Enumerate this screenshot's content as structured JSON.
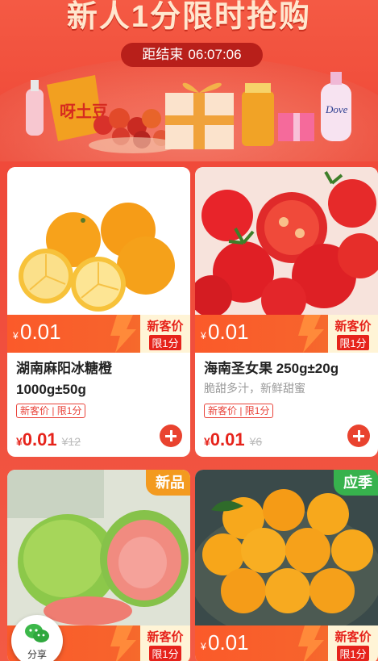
{
  "banner": {
    "title": "新人1分限时抢购",
    "countdown_label": "距结束",
    "countdown_time": "06:07:06"
  },
  "products": [
    {
      "name": "湖南麻阳冰糖橙1000g±50g",
      "subtitle": "",
      "price_currency": "¥",
      "price": "0.01",
      "tag_line1": "新客价",
      "tag_line2": "限1分",
      "badge": "新客价 | 限1分",
      "original_price": "¥12",
      "corner": ""
    },
    {
      "name": "海南圣女果 250g±20g",
      "subtitle": "脆甜多汁，新鲜甜蜜",
      "price_currency": "¥",
      "price": "0.01",
      "tag_line1": "新客价",
      "tag_line2": "限1分",
      "badge": "新客价 | 限1分",
      "original_price": "¥6",
      "corner": ""
    },
    {
      "name": "",
      "subtitle": "",
      "price_currency": "¥",
      "price": "",
      "tag_line1": "新客价",
      "tag_line2": "限1分",
      "corner": "新品",
      "corner_color": "#f39a1f"
    },
    {
      "name": "",
      "subtitle": "",
      "price_currency": "¥",
      "price": "0.01",
      "tag_line1": "新客价",
      "tag_line2": "限1分",
      "corner": "应季",
      "corner_color": "#37b24d"
    }
  ],
  "share": {
    "label": "分享",
    "icon": "wechat-icon"
  },
  "colors": {
    "accent": "#e6231b",
    "banner": "#ef4a3a",
    "price_band": "#fb5a2a"
  }
}
